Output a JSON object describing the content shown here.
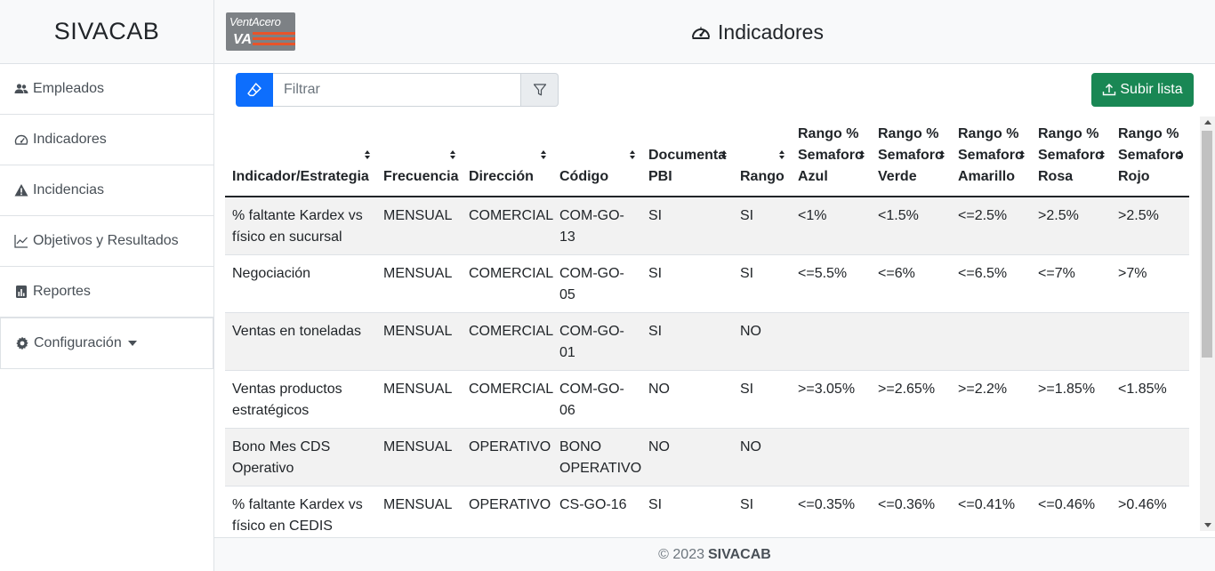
{
  "app": {
    "brand": "SIVACAB",
    "logo_text": "VentAcero",
    "logo_mark": "VA"
  },
  "sidebar": {
    "items": [
      {
        "label": "Empleados",
        "icon": "users-icon"
      },
      {
        "label": "Indicadores",
        "icon": "speedometer-icon"
      },
      {
        "label": "Incidencias",
        "icon": "warning-icon"
      },
      {
        "label": "Objetivos y Resultados",
        "icon": "line-chart-icon"
      },
      {
        "label": "Reportes",
        "icon": "bar-report-icon"
      },
      {
        "label": "Configuración",
        "icon": "gear-icon"
      }
    ]
  },
  "header": {
    "title": "Indicadores",
    "icon": "speedometer-icon"
  },
  "toolbar": {
    "filter_placeholder": "Filtrar",
    "filter_value": "",
    "upload_label": "Subir lista"
  },
  "table": {
    "columns": [
      "Indicador/Estrategia",
      "Frecuencia",
      "Dirección",
      "Código",
      "Documenta PBI",
      "Rango",
      "Rango % Semaforo Azul",
      "Rango % Semaforo Verde",
      "Rango % Semaforo Amarillo",
      "Rango % Semaforo Rosa",
      "Rango % Semaforo Rojo"
    ],
    "rows": [
      [
        "% faltante Kardex vs físico en sucursal",
        "MENSUAL",
        "COMERCIAL",
        "COM-GO-13",
        "SI",
        "SI",
        "<1%",
        "<1.5%",
        "<=2.5%",
        ">2.5%",
        ">2.5%"
      ],
      [
        "Negociación",
        "MENSUAL",
        "COMERCIAL",
        "COM-GO-05",
        "SI",
        "SI",
        "<=5.5%",
        "<=6%",
        "<=6.5%",
        "<=7%",
        ">7%"
      ],
      [
        "Ventas en toneladas",
        "MENSUAL",
        "COMERCIAL",
        "COM-GO-01",
        "SI",
        "NO",
        "",
        "",
        "",
        "",
        ""
      ],
      [
        "Ventas productos estratégicos",
        "MENSUAL",
        "COMERCIAL",
        "COM-GO-06",
        "NO",
        "SI",
        ">=3.05%",
        ">=2.65%",
        ">=2.2%",
        ">=1.85%",
        "<1.85%"
      ],
      [
        "Bono Mes CDS Operativo",
        "MENSUAL",
        "OPERATIVO",
        "BONO OPERATIVO",
        "NO",
        "NO",
        "",
        "",
        "",
        "",
        ""
      ],
      [
        "% faltante Kardex vs físico en CEDIS",
        "MENSUAL",
        "OPERATIVO",
        "CS-GO-16",
        "SI",
        "SI",
        "<=0.35%",
        "<=0.36%",
        "<=0.41%",
        "<=0.46%",
        ">0.46%"
      ]
    ]
  },
  "footer": {
    "copyright": "© 2023",
    "brand": "SIVACAB"
  }
}
